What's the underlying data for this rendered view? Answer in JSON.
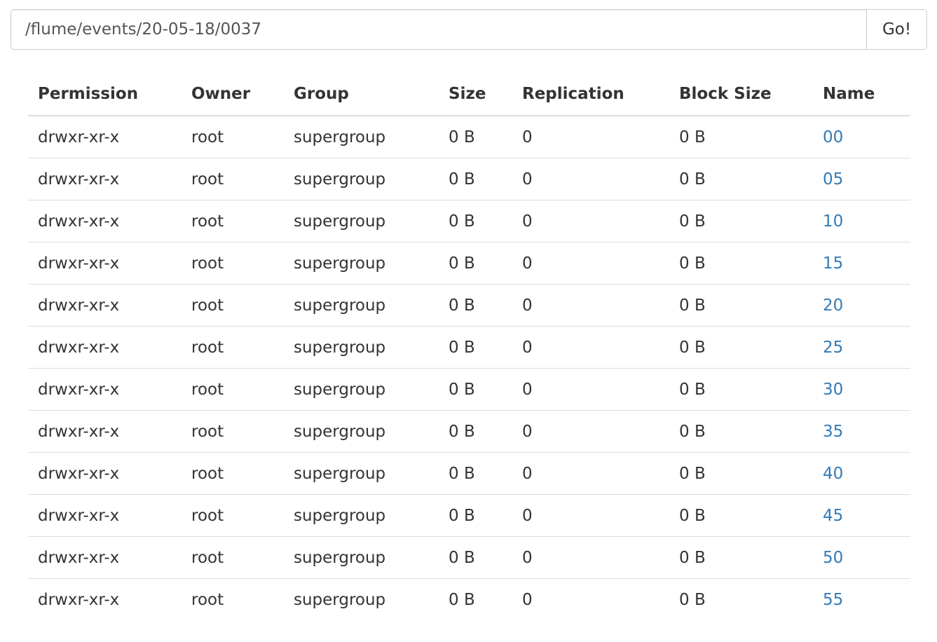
{
  "path_bar": {
    "value": "/flume/events/20-05-18/0037",
    "go_label": "Go!"
  },
  "table": {
    "columns": [
      "Permission",
      "Owner",
      "Group",
      "Size",
      "Replication",
      "Block Size",
      "Name"
    ],
    "rows": [
      {
        "permission": "drwxr-xr-x",
        "owner": "root",
        "group": "supergroup",
        "size": "0 B",
        "replication": "0",
        "block_size": "0 B",
        "name": "00"
      },
      {
        "permission": "drwxr-xr-x",
        "owner": "root",
        "group": "supergroup",
        "size": "0 B",
        "replication": "0",
        "block_size": "0 B",
        "name": "05"
      },
      {
        "permission": "drwxr-xr-x",
        "owner": "root",
        "group": "supergroup",
        "size": "0 B",
        "replication": "0",
        "block_size": "0 B",
        "name": "10"
      },
      {
        "permission": "drwxr-xr-x",
        "owner": "root",
        "group": "supergroup",
        "size": "0 B",
        "replication": "0",
        "block_size": "0 B",
        "name": "15"
      },
      {
        "permission": "drwxr-xr-x",
        "owner": "root",
        "group": "supergroup",
        "size": "0 B",
        "replication": "0",
        "block_size": "0 B",
        "name": "20"
      },
      {
        "permission": "drwxr-xr-x",
        "owner": "root",
        "group": "supergroup",
        "size": "0 B",
        "replication": "0",
        "block_size": "0 B",
        "name": "25"
      },
      {
        "permission": "drwxr-xr-x",
        "owner": "root",
        "group": "supergroup",
        "size": "0 B",
        "replication": "0",
        "block_size": "0 B",
        "name": "30"
      },
      {
        "permission": "drwxr-xr-x",
        "owner": "root",
        "group": "supergroup",
        "size": "0 B",
        "replication": "0",
        "block_size": "0 B",
        "name": "35"
      },
      {
        "permission": "drwxr-xr-x",
        "owner": "root",
        "group": "supergroup",
        "size": "0 B",
        "replication": "0",
        "block_size": "0 B",
        "name": "40"
      },
      {
        "permission": "drwxr-xr-x",
        "owner": "root",
        "group": "supergroup",
        "size": "0 B",
        "replication": "0",
        "block_size": "0 B",
        "name": "45"
      },
      {
        "permission": "drwxr-xr-x",
        "owner": "root",
        "group": "supergroup",
        "size": "0 B",
        "replication": "0",
        "block_size": "0 B",
        "name": "50"
      },
      {
        "permission": "drwxr-xr-x",
        "owner": "root",
        "group": "supergroup",
        "size": "0 B",
        "replication": "0",
        "block_size": "0 B",
        "name": "55"
      }
    ]
  },
  "colors": {
    "link": "#337ab7",
    "text": "#333333",
    "border": "#dddddd"
  }
}
